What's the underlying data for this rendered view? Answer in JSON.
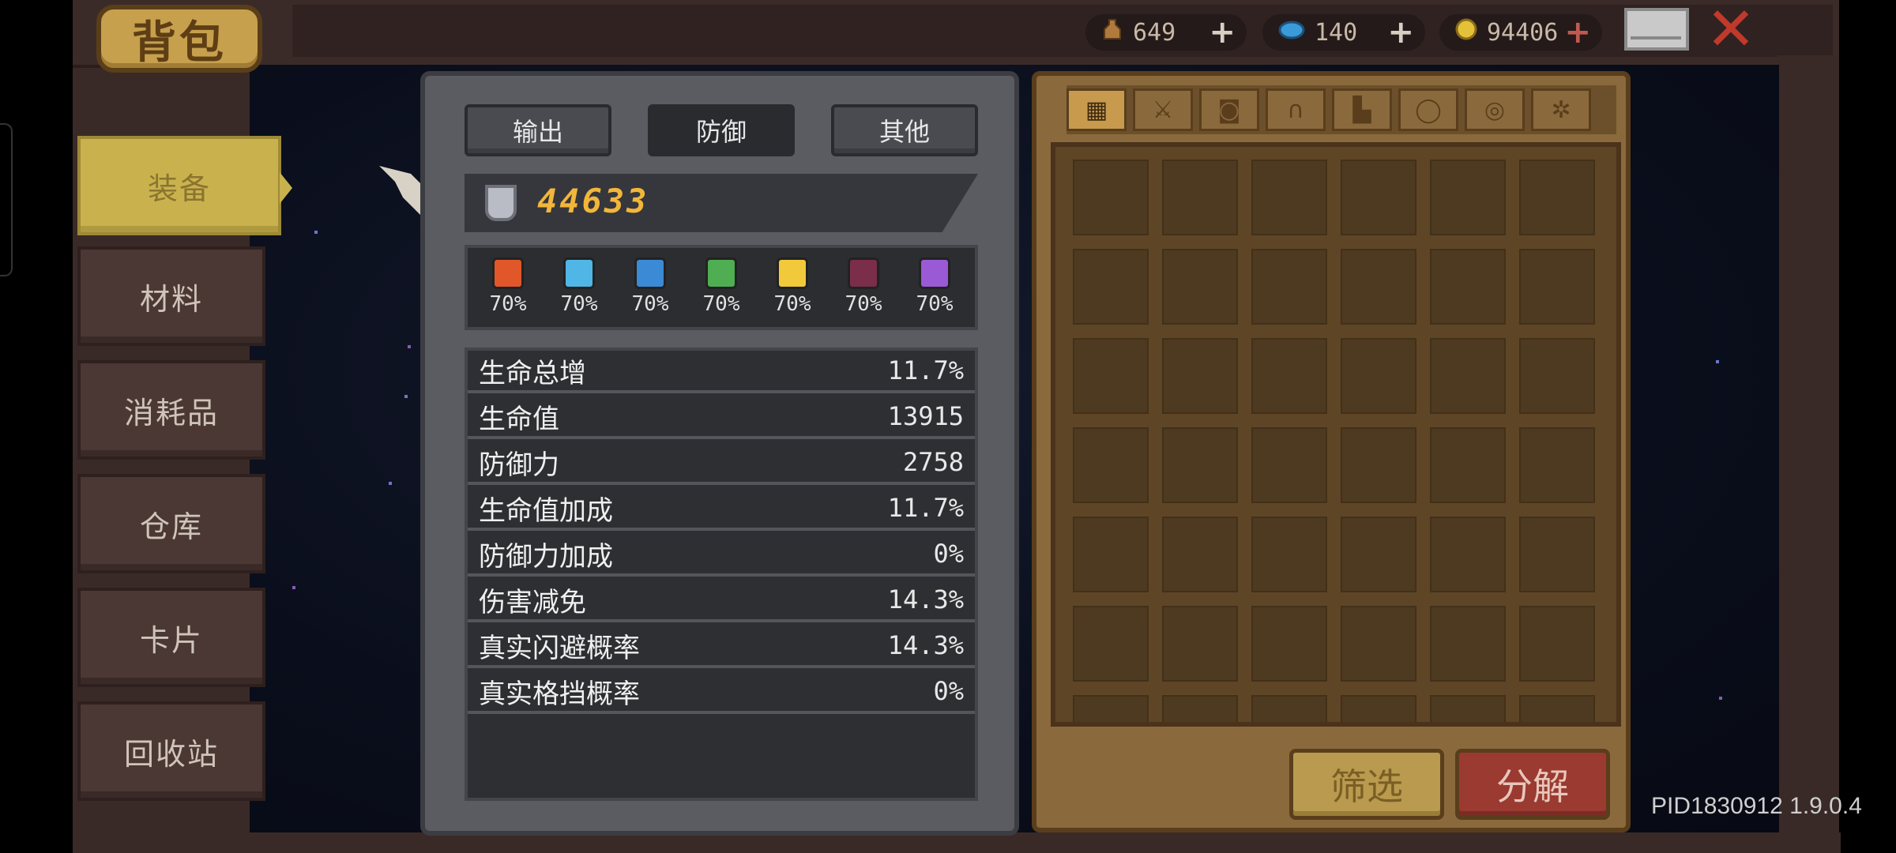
{
  "header": {
    "title": "背包",
    "currencies": [
      {
        "icon": "bottle-icon",
        "value": "649",
        "has_plus": true,
        "color": "#b07a3c"
      },
      {
        "icon": "gem-icon",
        "value": "140",
        "has_plus": true,
        "color": "#3a9bd8"
      },
      {
        "icon": "coin-icon",
        "value": "94406",
        "has_plus": true,
        "color": "#e3c23a"
      }
    ],
    "mail_icon": "envelope-icon",
    "close_icon": "close-icon"
  },
  "sidebar": {
    "items": [
      {
        "label": "装备",
        "active": true
      },
      {
        "label": "材料",
        "active": false
      },
      {
        "label": "消耗品",
        "active": false
      },
      {
        "label": "仓库",
        "active": false
      },
      {
        "label": "卡片",
        "active": false
      },
      {
        "label": "回收站",
        "active": false
      }
    ]
  },
  "stats": {
    "tabs": [
      {
        "label": "输出",
        "active": false
      },
      {
        "label": "防御",
        "active": true
      },
      {
        "label": "其他",
        "active": false
      }
    ],
    "score": "44633",
    "resistances": [
      {
        "icon": "fire-icon",
        "color": "#e2572a",
        "value": "70%"
      },
      {
        "icon": "ice-icon",
        "color": "#4fb6e6",
        "value": "70%"
      },
      {
        "icon": "lightning-icon",
        "color": "#3a8ad6",
        "value": "70%"
      },
      {
        "icon": "poison-icon",
        "color": "#4fae52",
        "value": "70%"
      },
      {
        "icon": "light-icon",
        "color": "#f2c93a",
        "value": "70%"
      },
      {
        "icon": "dark-icon",
        "color": "#7a2e4a",
        "value": "70%"
      },
      {
        "icon": "arcane-icon",
        "color": "#9a5ad6",
        "value": "70%"
      }
    ],
    "rows": [
      {
        "label": "生命总增",
        "value": "11.7%"
      },
      {
        "label": "生命值",
        "value": "13915"
      },
      {
        "label": "防御力",
        "value": "2758"
      },
      {
        "label": "生命值加成",
        "value": "11.7%"
      },
      {
        "label": "防御力加成",
        "value": "0%"
      },
      {
        "label": "伤害减免",
        "value": "14.3%"
      },
      {
        "label": "真实闪避概率",
        "value": "14.3%"
      },
      {
        "label": "真实格挡概率",
        "value": "0%"
      }
    ]
  },
  "inventory": {
    "category_tabs": [
      {
        "icon": "grid-icon",
        "glyph": "▦",
        "active": true
      },
      {
        "icon": "sword-icon",
        "glyph": "⚔",
        "active": false
      },
      {
        "icon": "armor-icon",
        "glyph": "◙",
        "active": false
      },
      {
        "icon": "helmet-icon",
        "glyph": "∩",
        "active": false
      },
      {
        "icon": "boots-icon",
        "glyph": "▙",
        "active": false
      },
      {
        "icon": "necklace-icon",
        "glyph": "◯",
        "active": false
      },
      {
        "icon": "ring-icon",
        "glyph": "◎",
        "active": false
      },
      {
        "icon": "gear-icon",
        "glyph": "✲",
        "active": false
      }
    ],
    "filter_label": "筛选",
    "decompose_label": "分解"
  },
  "footer": {
    "pid": "PID1830912 1.9.0.4"
  }
}
